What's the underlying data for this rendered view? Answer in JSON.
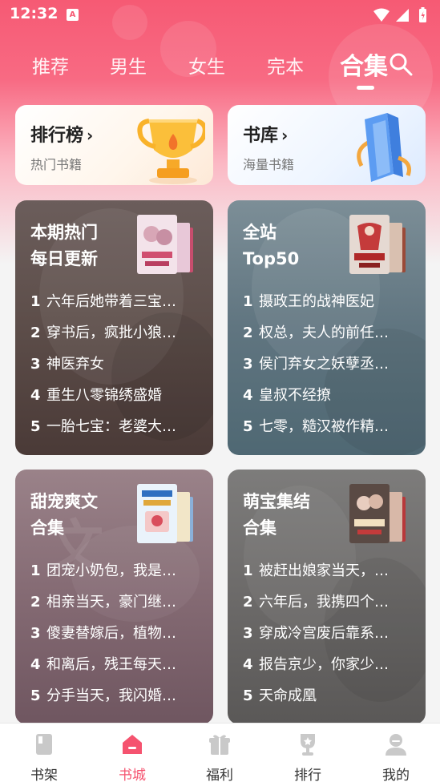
{
  "status_bar": {
    "time": "12:32",
    "notification_letter": "A"
  },
  "tabs": [
    {
      "label": "推荐"
    },
    {
      "label": "男生"
    },
    {
      "label": "女生"
    },
    {
      "label": "完本"
    },
    {
      "label": "合集"
    }
  ],
  "active_tab": "合集",
  "feature_cards": {
    "ranking": {
      "title": "排行榜",
      "subtitle": "热门书籍",
      "chevron": "›"
    },
    "library": {
      "title": "书库",
      "subtitle": "海量书籍",
      "chevron": "›"
    }
  },
  "collections": [
    {
      "title_line1": "本期热门",
      "title_line2": "每日更新",
      "items": [
        {
          "rank": "1",
          "text": "六年后她带着三宝…"
        },
        {
          "rank": "2",
          "text": "穿书后，疯批小狼…"
        },
        {
          "rank": "3",
          "text": "神医弃女"
        },
        {
          "rank": "4",
          "text": "重生八零锦绣盛婚"
        },
        {
          "rank": "5",
          "text": "一胎七宝：老婆大…"
        }
      ]
    },
    {
      "title_line1": "全站",
      "title_line2": "Top50",
      "items": [
        {
          "rank": "1",
          "text": "摄政王的战神医妃"
        },
        {
          "rank": "2",
          "text": "权总，夫人的前任…"
        },
        {
          "rank": "3",
          "text": "侯门弃女之妖孽丞…"
        },
        {
          "rank": "4",
          "text": "皇叔不经撩"
        },
        {
          "rank": "5",
          "text": "七零，糙汉被作精…"
        }
      ]
    },
    {
      "title_line1": "甜宠爽文",
      "title_line2": "合集",
      "items": [
        {
          "rank": "1",
          "text": "团宠小奶包，我是…"
        },
        {
          "rank": "2",
          "text": "相亲当天，豪门继…"
        },
        {
          "rank": "3",
          "text": "傻妻替嫁后，植物…"
        },
        {
          "rank": "4",
          "text": "和离后，残王每天…"
        },
        {
          "rank": "5",
          "text": "分手当天，我闪婚…"
        }
      ]
    },
    {
      "title_line1": "萌宝集结",
      "title_line2": "合集",
      "items": [
        {
          "rank": "1",
          "text": "被赶出娘家当天，…"
        },
        {
          "rank": "2",
          "text": "六年后，我携四个…"
        },
        {
          "rank": "3",
          "text": "穿成冷宫废后靠系…"
        },
        {
          "rank": "4",
          "text": "报告京少，你家少…"
        },
        {
          "rank": "5",
          "text": "天命成凰"
        }
      ]
    }
  ],
  "bottom_nav": [
    {
      "label": "书架",
      "icon": "book-icon"
    },
    {
      "label": "书城",
      "icon": "home-icon"
    },
    {
      "label": "福利",
      "icon": "gift-icon"
    },
    {
      "label": "排行",
      "icon": "trophy-icon"
    },
    {
      "label": "我的",
      "icon": "user-icon"
    }
  ],
  "active_nav": "书城",
  "colors": {
    "brand": "#f65a74",
    "active_nav": "#f5536f",
    "inactive_nav": "#c9c9c9"
  }
}
